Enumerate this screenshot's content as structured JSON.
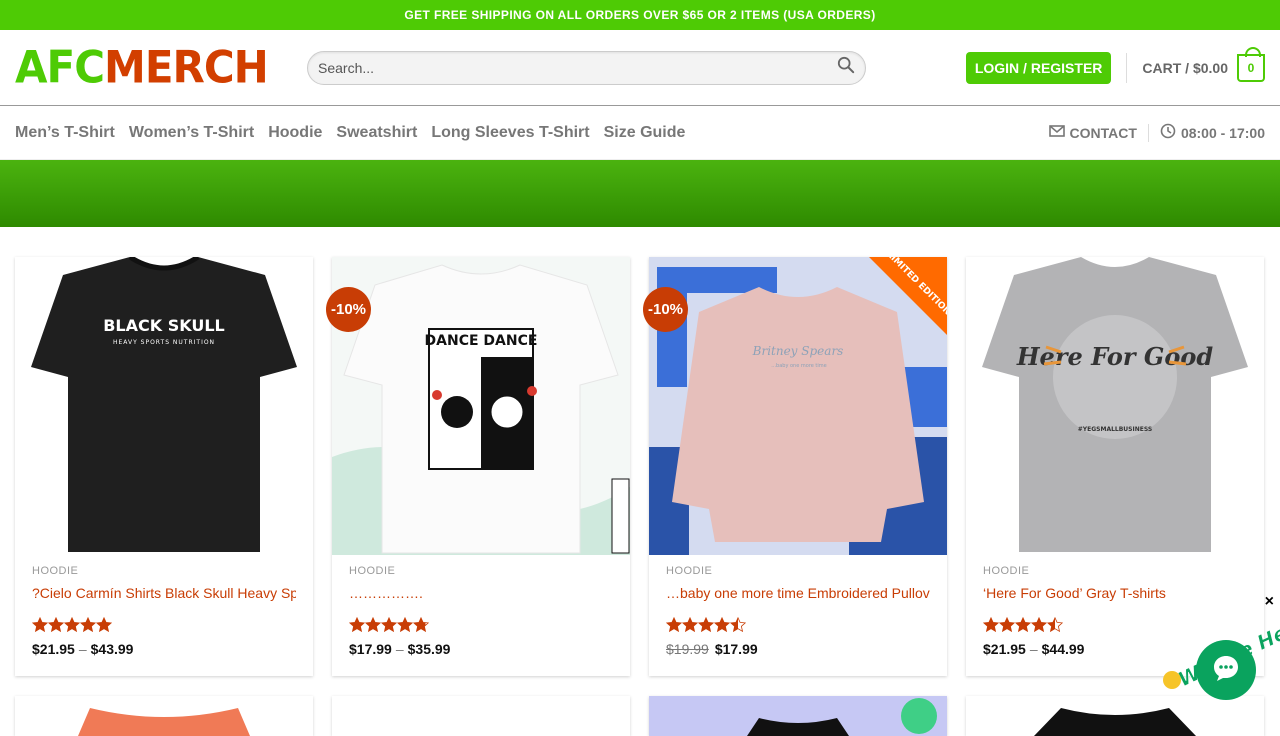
{
  "topbar": {
    "text": "GET FREE SHIPPING ON ALL ORDERS OVER $65 OR 2 ITEMS (USA ORDERS)"
  },
  "header": {
    "logo_part1": "AFC",
    "logo_part2": "MERCH",
    "search_placeholder": "Search...",
    "login_label": "LOGIN / REGISTER",
    "cart_label": "CART / $0.00",
    "cart_count": "0"
  },
  "nav": {
    "items": [
      "Men’s T-Shirt",
      "Women’s T-Shirt",
      "Hoodie",
      "Sweatshirt",
      "Long Sleeves T-Shirt",
      "Size Guide"
    ],
    "contact": "CONTACT",
    "hours": "08:00 - 17:00"
  },
  "products": [
    {
      "category": "HOODIE",
      "title": "?Cielo Carmín Shirts Black Skull Heavy Sports Nutrition",
      "rating": 5,
      "price_low": "$21.95",
      "price_high": "$43.99",
      "image_text": "BLACK SKULL",
      "image_subtext": "HEAVY SPORTS NUTRITION"
    },
    {
      "category": "HOODIE",
      "title": "…………….",
      "rating": 4.8,
      "badge": "-10%",
      "price_low": "$17.99",
      "price_high": "$35.99",
      "image_text": "DANCE DANCE"
    },
    {
      "category": "HOODIE",
      "title": "…baby one more time Embroidered Pullover",
      "rating": 4.5,
      "badge": "-10%",
      "old_price": "$19.99",
      "price": "$17.99",
      "ribbon": "LIMITED EDITION",
      "image_text": "Britney Spears",
      "image_subtext": "...baby one more time"
    },
    {
      "category": "HOODIE",
      "title": "‘Here For Good’ Gray T-shirts",
      "rating": 4.5,
      "price_low": "$21.95",
      "price_high": "$44.99",
      "image_text": "Here For Good",
      "image_subtext": "#YEGSMALLBUSINESS"
    }
  ],
  "chat": {
    "bubble_text": "We Are Here!",
    "close": "×"
  },
  "colors": {
    "brand_green": "#4ecb05",
    "accent_orange": "#c83d05",
    "chat_green": "#0aa35e"
  }
}
